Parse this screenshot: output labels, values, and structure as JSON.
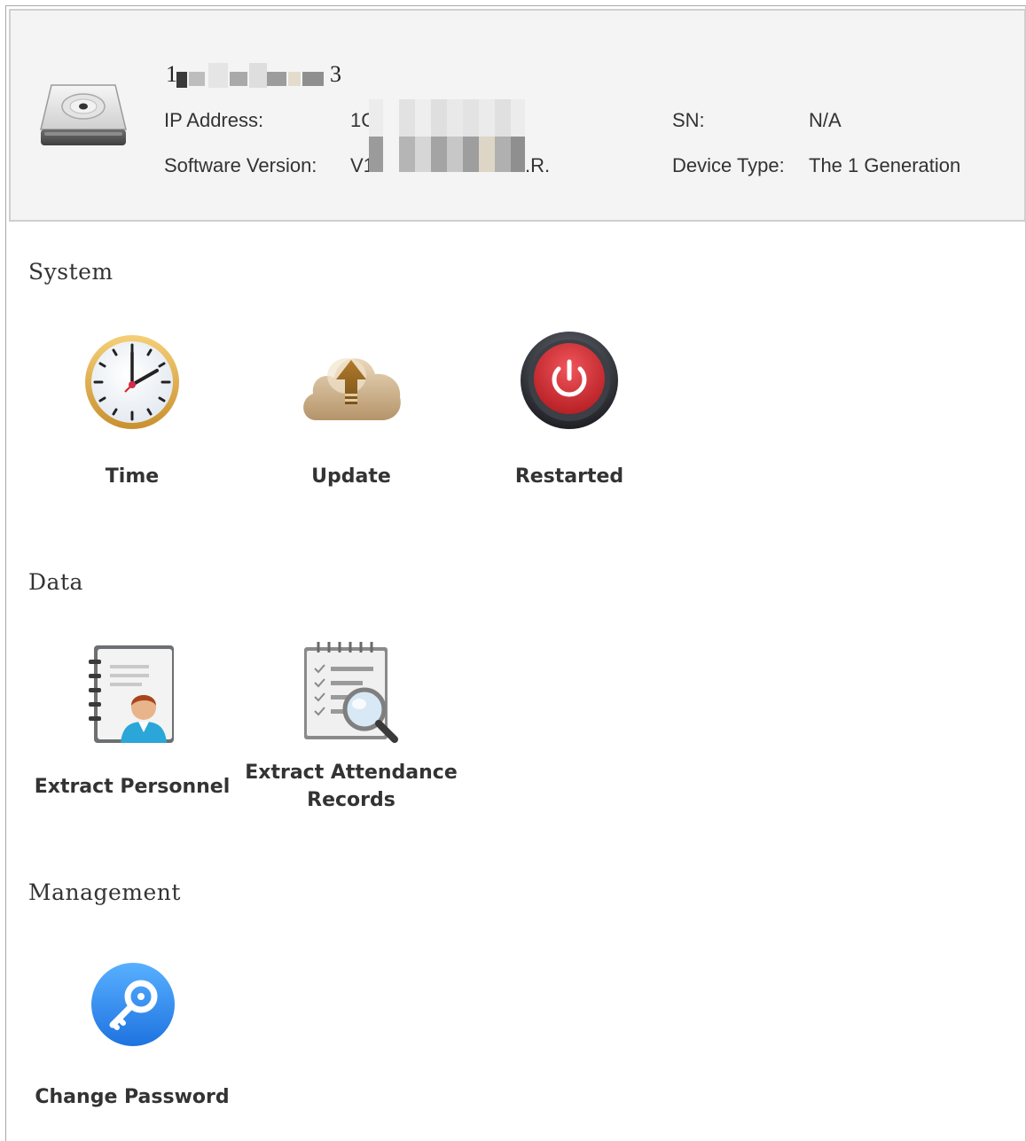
{
  "device": {
    "name_prefix": "1",
    "name_suffix": "3",
    "ip_address_label": "IP Address:",
    "ip_address_value_prefix": "1C",
    "software_version_label": "Software Version:",
    "software_version_prefix": "V1",
    "software_version_suffix": ".R.",
    "sn_label": "SN:",
    "sn_value": "N/A",
    "device_type_label": "Device Type:",
    "device_type_value": "The 1 Generation",
    "icon": "hard-drive-icon"
  },
  "sections": [
    {
      "title": "System",
      "items": [
        {
          "label": "Time",
          "icon": "clock-icon"
        },
        {
          "label": "Update",
          "icon": "cloud-upload-icon"
        },
        {
          "label": "Restarted",
          "icon": "power-icon"
        }
      ]
    },
    {
      "title": "Data",
      "items": [
        {
          "label": "Extract Personnel",
          "icon": "personnel-book-icon"
        },
        {
          "label": "Extract Attendance Records",
          "icon": "attendance-records-icon"
        }
      ]
    },
    {
      "title": "Management",
      "items": [
        {
          "label": "Change Password",
          "icon": "key-icon"
        }
      ]
    }
  ],
  "colors": {
    "header_bg": "#f4f4f4",
    "power_red": "#d83a3a",
    "key_blue": "#2f8ff0",
    "clock_rim": "#e8b64a",
    "cloud_tan": "#c9ad86"
  }
}
